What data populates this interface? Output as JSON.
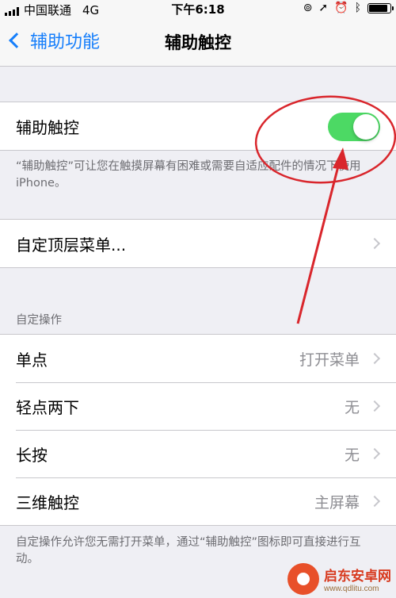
{
  "status_bar": {
    "carrier": "中国联通",
    "network": "4G",
    "time": "下午6:18",
    "right_icons": [
      "lock-rotation-icon",
      "location-icon",
      "alarm-icon",
      "bluetooth-icon",
      "battery-icon"
    ],
    "battery_level": 0.9
  },
  "nav": {
    "back_label": "辅助功能",
    "title": "辅助触控"
  },
  "assistive_touch": {
    "label": "辅助触控",
    "enabled": true,
    "toggle_color": "#4cd964",
    "footnote": "“辅助触控”可让您在触摸屏幕有困难或需要自适应配件的情况下使用 iPhone。"
  },
  "top_menu": {
    "label": "自定顶层菜单..."
  },
  "custom_actions": {
    "header": "自定操作",
    "rows": [
      {
        "label": "单点",
        "value": "打开菜单"
      },
      {
        "label": "轻点两下",
        "value": "无"
      },
      {
        "label": "长按",
        "value": "无"
      },
      {
        "label": "三维触控",
        "value": "主屏幕"
      }
    ],
    "footnote": "自定操作允许您无需打开菜单，通过“辅助触控”图标即可直接进行互动。"
  },
  "watermark": {
    "title": "启东安卓网",
    "url": "www.qdlitu.com"
  },
  "colors": {
    "accent": "#157efb",
    "annotation": "#d9262c"
  }
}
